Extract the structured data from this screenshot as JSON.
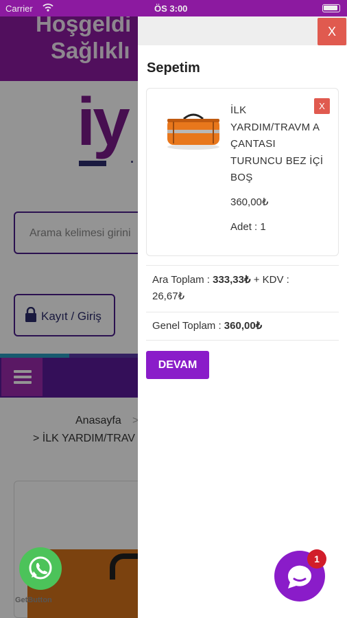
{
  "status_bar": {
    "carrier": "Carrier",
    "time": "ÖS 3:00"
  },
  "background": {
    "hero_line1": "Hoşgeldi",
    "hero_line2": "Sağlıklı",
    "logo_text": "iy",
    "search_placeholder": "Arama kelimesi girini",
    "login_label": "Kayıt / Giriş",
    "breadcrumb_home": "Anasayfa",
    "breadcrumb_sep": ">",
    "breadcrumb_current": "> İLK YARDIM/TRAV",
    "menu_icon": "hamburger-menu-icon",
    "stripe_colors": [
      "#2a9cc0",
      "#5a3aa8",
      "#8c2aa0",
      "#e05a2a",
      "#5a1a9a"
    ]
  },
  "drawer": {
    "close_label": "X",
    "title": "Sepetim",
    "item": {
      "name": "İLK YARDIM/TRAVM A ÇANTASI TURUNCU BEZ İÇİ BOŞ",
      "price": "360,00₺",
      "quantity": "Adet : 1",
      "remove_label": "X",
      "image_icon": "orange-first-aid-bag-image"
    },
    "subtotal": {
      "label": "Ara Toplam :",
      "amount": "333,33₺",
      "vat_text": "+ KDV :",
      "vat_amount": "26,67₺"
    },
    "grand_total": {
      "label": "Genel Toplam :",
      "amount": "360,00₺"
    },
    "continue_label": "DEVAM"
  },
  "floating": {
    "whatsapp_icon": "whatsapp-icon",
    "getbutton_label": "GetButton",
    "chat_icon": "chat-bubble-icon",
    "chat_badge": "1"
  },
  "colors": {
    "brand_purple": "#8a1cc9",
    "hero_magenta": "#8c1aa0",
    "close_red": "#e05a4f",
    "whatsapp_green": "#4cc35a",
    "badge_red": "#d11d2a"
  }
}
